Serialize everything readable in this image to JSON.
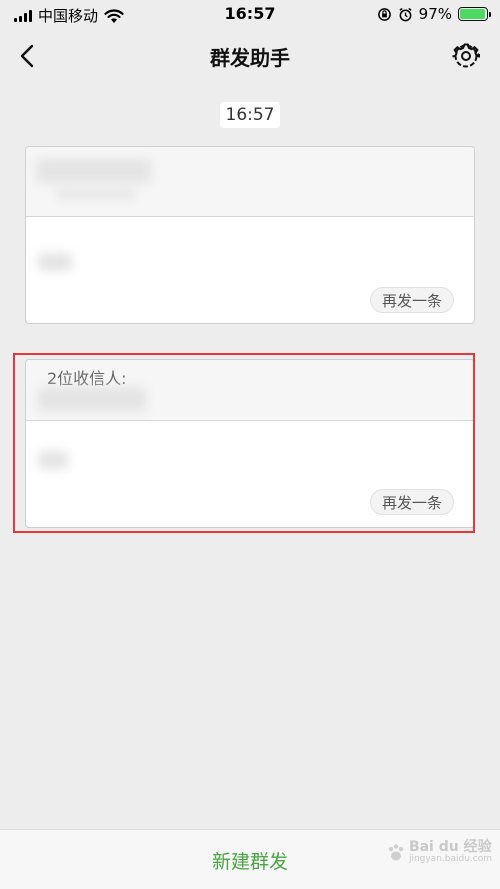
{
  "status_bar": {
    "carrier": "中国移动",
    "time": "16:57",
    "battery_percent": "97%",
    "battery_level": 0.97
  },
  "nav": {
    "title": "群发助手"
  },
  "time_chip": "16:57",
  "cards": [
    {
      "resend_label": "再发一条"
    },
    {
      "recipients_label": "2位收信人:",
      "resend_label": "再发一条"
    }
  ],
  "bottom": {
    "new_broadcast_label": "新建群发"
  },
  "watermark": {
    "text": "Bai du 经验",
    "sub": "jingyan.baidu.com"
  },
  "colors": {
    "accent_green": "#4aa544",
    "highlight_red": "#e03a3a",
    "battery_green": "#4cd964"
  }
}
